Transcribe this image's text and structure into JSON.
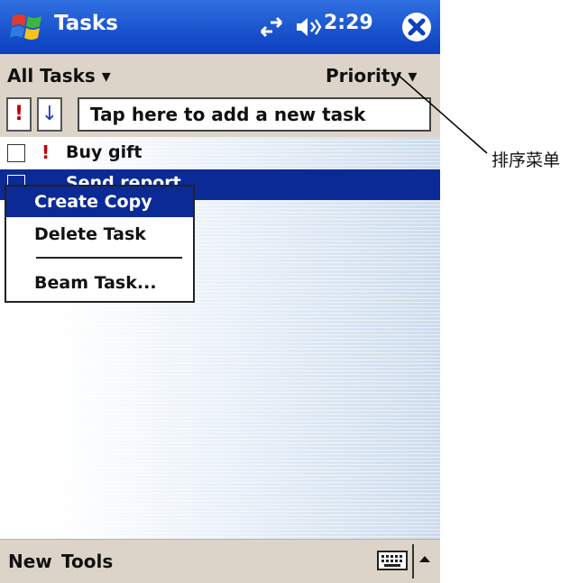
{
  "titlebar": {
    "app_title": "Tasks",
    "clock": "2:29",
    "icons": [
      "start-flag-icon",
      "connectivity-icon",
      "volume-icon",
      "close-icon"
    ]
  },
  "filterbar": {
    "filter_label": "All Tasks ▾",
    "sort_label": "Priority ▾"
  },
  "entrybar": {
    "priority_button": "!",
    "sort_direction_button": "↓",
    "input_placeholder": "Tap here to add a new task",
    "input_value": ""
  },
  "tasks": [
    {
      "priority": "!",
      "title": "Buy gift",
      "selected": false
    },
    {
      "priority": "",
      "title": "Send report",
      "selected": true
    }
  ],
  "context_menu": {
    "items": [
      "Create Copy",
      "Delete Task",
      "Beam Task..."
    ],
    "highlighted": "Create Copy"
  },
  "bottombar": {
    "new_label": "New",
    "tools_label": "Tools"
  },
  "annotation": {
    "label": "排序菜单"
  },
  "colors": {
    "titlebar": "#1c52d4",
    "selection": "#0b2a96",
    "bar_background": "#ddd4c9",
    "priority_mark": "#c00000"
  }
}
